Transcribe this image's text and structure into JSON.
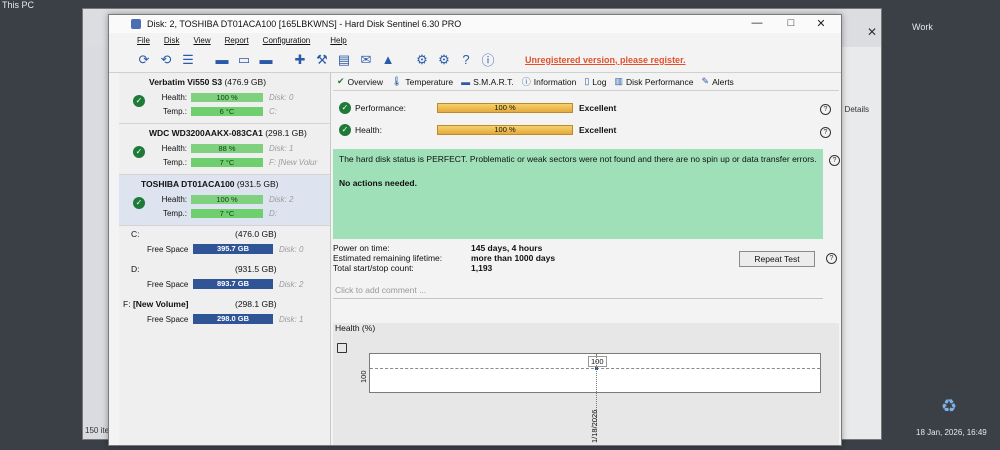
{
  "window": {
    "title": "Disk: 2, TOSHIBA DT01ACA100 [165LBKWNS]  -  Hard Disk Sentinel 6.30 PRO",
    "minimize": "—",
    "maximize": "□",
    "close": "✕"
  },
  "menu": {
    "file": "File",
    "disk": "Disk",
    "view": "View",
    "report": "Report",
    "configuration": "Configuration",
    "help": "Help"
  },
  "toolbar": {
    "unregistered": "Unregistered version, please register."
  },
  "disks": [
    {
      "name": "Verbatim Vi550 S3",
      "size": "(476.9 GB)",
      "health": "100 %",
      "temp": "6 °C",
      "health_disk": "Disk: 0",
      "temp_drive": "C:"
    },
    {
      "name": "WDC WD3200AAKX-083CA1",
      "size": "(298.1 GB)",
      "health": "88 %",
      "temp": "7 °C",
      "health_disk": "Disk: 1",
      "temp_drive": "F: [New Volur"
    },
    {
      "name": "TOSHIBA DT01ACA100",
      "size": "(931.5 GB)",
      "health": "100 %",
      "temp": "7 °C",
      "health_disk": "Disk: 2",
      "temp_drive": "D:"
    }
  ],
  "labels": {
    "health": "Health:",
    "temp": "Temp.:",
    "free_space": "Free Space"
  },
  "volumes": [
    {
      "name": "C:",
      "name_bold": "",
      "size": "(476.0 GB)",
      "free": "395.7 GB",
      "disk": "Disk: 0"
    },
    {
      "name": "D:",
      "name_bold": "",
      "size": "(931.5 GB)",
      "free": "893.7 GB",
      "disk": "Disk: 2"
    },
    {
      "name": "F:",
      "name_bold": "[New Volume]",
      "size": "(298.1 GB)",
      "free": "298.0 GB",
      "disk": "Disk: 1"
    }
  ],
  "tabs": [
    "Overview",
    "Temperature",
    "S.M.A.R.T.",
    "Information",
    "Log",
    "Disk Performance",
    "Alerts"
  ],
  "overview": {
    "performance_label": "Performance:",
    "performance_value": "100 %",
    "performance_text": "Excellent",
    "health_label": "Health:",
    "health_value": "100 %",
    "health_text": "Excellent",
    "status_text": "The hard disk status is PERFECT. Problematic or weak sectors were not found and there are no spin up or data transfer errors.",
    "actions": "No actions needed.",
    "power_on_label": "Power on time:",
    "power_on_value": "145 days, 4 hours",
    "lifetime_label": "Estimated remaining lifetime:",
    "lifetime_value": "more than 1000 days",
    "startstop_label": "Total start/stop count:",
    "startstop_value": "1,193",
    "repeat_test": "Repeat Test",
    "comment_placeholder": "Click to add comment ...",
    "health_chart_title": "Health (%)"
  },
  "chart_data": {
    "type": "line",
    "title": "Health (%)",
    "x": [
      "1/18/2026"
    ],
    "values": [
      100
    ],
    "point_label": "100",
    "ytick": "100"
  },
  "desktop": {
    "this_pc": "This PC",
    "details": "Details",
    "item_count": "150 ite",
    "work": "Work",
    "clock": "18 Jan, 2026, 16:49"
  }
}
